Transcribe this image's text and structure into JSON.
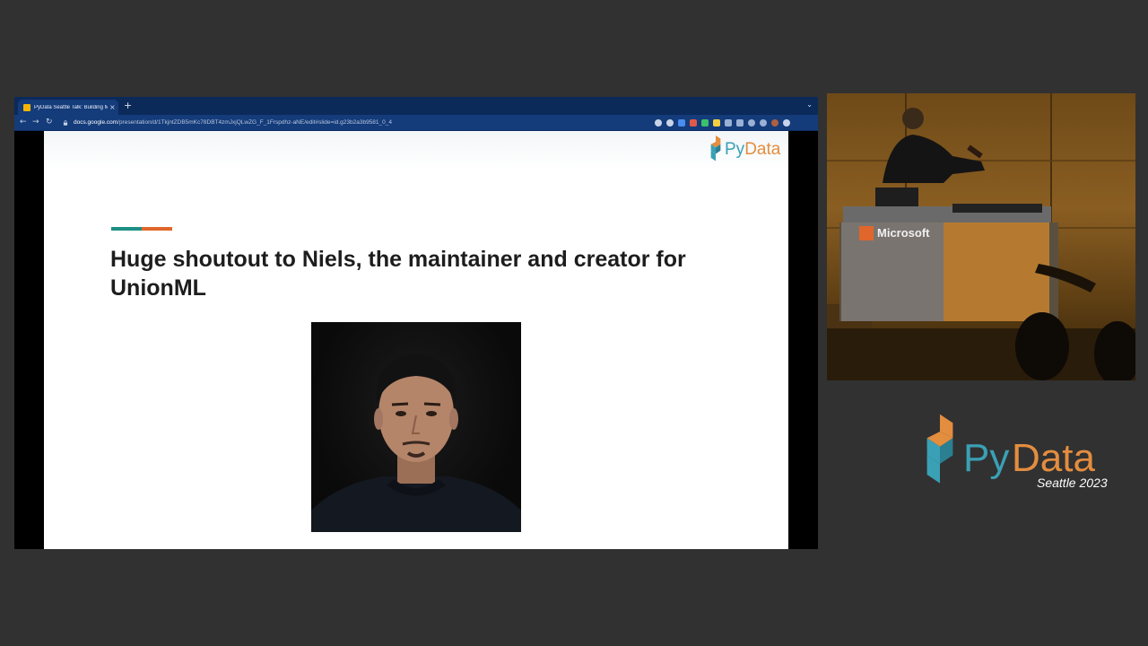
{
  "browser": {
    "tab_title": "PyData Seattle Talk: Building M",
    "tab_close": "×",
    "new_tab": "+",
    "tab_menu": "⌄",
    "nav": {
      "back": "←",
      "forward": "→",
      "reload": "↻"
    },
    "url_host": "docs.google.com",
    "url_path": "/presentation/d/1TkjntZDB5mKc78DBT4zmJxjQLwZG_F_1Frspdhz-aNE/edit#slide=id.g23b2a3b9581_0_4",
    "extensions": [
      {
        "name": "share-icon",
        "color": "#c8d4ea"
      },
      {
        "name": "star-icon",
        "color": "#c8d4ea"
      },
      {
        "name": "extension-blue-icon",
        "color": "#4a8cf0"
      },
      {
        "name": "extension-red-icon",
        "color": "#e05a4a"
      },
      {
        "name": "extension-green-icon",
        "color": "#3cc06a"
      },
      {
        "name": "extension-yellow-icon",
        "color": "#f4d03f"
      },
      {
        "name": "extension-puzzle-icon",
        "color": "#9ab0d4"
      },
      {
        "name": "extension-grey-icon",
        "color": "#9ab0d4"
      },
      {
        "name": "reading-list-icon",
        "color": "#9ab0d4"
      },
      {
        "name": "side-panel-icon",
        "color": "#9ab0d4"
      },
      {
        "name": "profile-avatar-icon",
        "color": "#b06040"
      },
      {
        "name": "kebab-menu-icon",
        "color": "#c8d4ea"
      }
    ]
  },
  "slide": {
    "logo_py": "Py",
    "logo_data": "Data",
    "title": "Huge shoutout to Niels, the maintainer and creator for UnionML",
    "accent_colors": {
      "teal": "#1d8f84",
      "orange": "#e0662b"
    }
  },
  "webcam": {
    "podium_label": "Microsoft"
  },
  "conference": {
    "py": "Py",
    "data": "Data",
    "subtitle": "Seattle 2023",
    "colors": {
      "blue": "#3aa0b5",
      "orange": "#e38d3f"
    }
  }
}
